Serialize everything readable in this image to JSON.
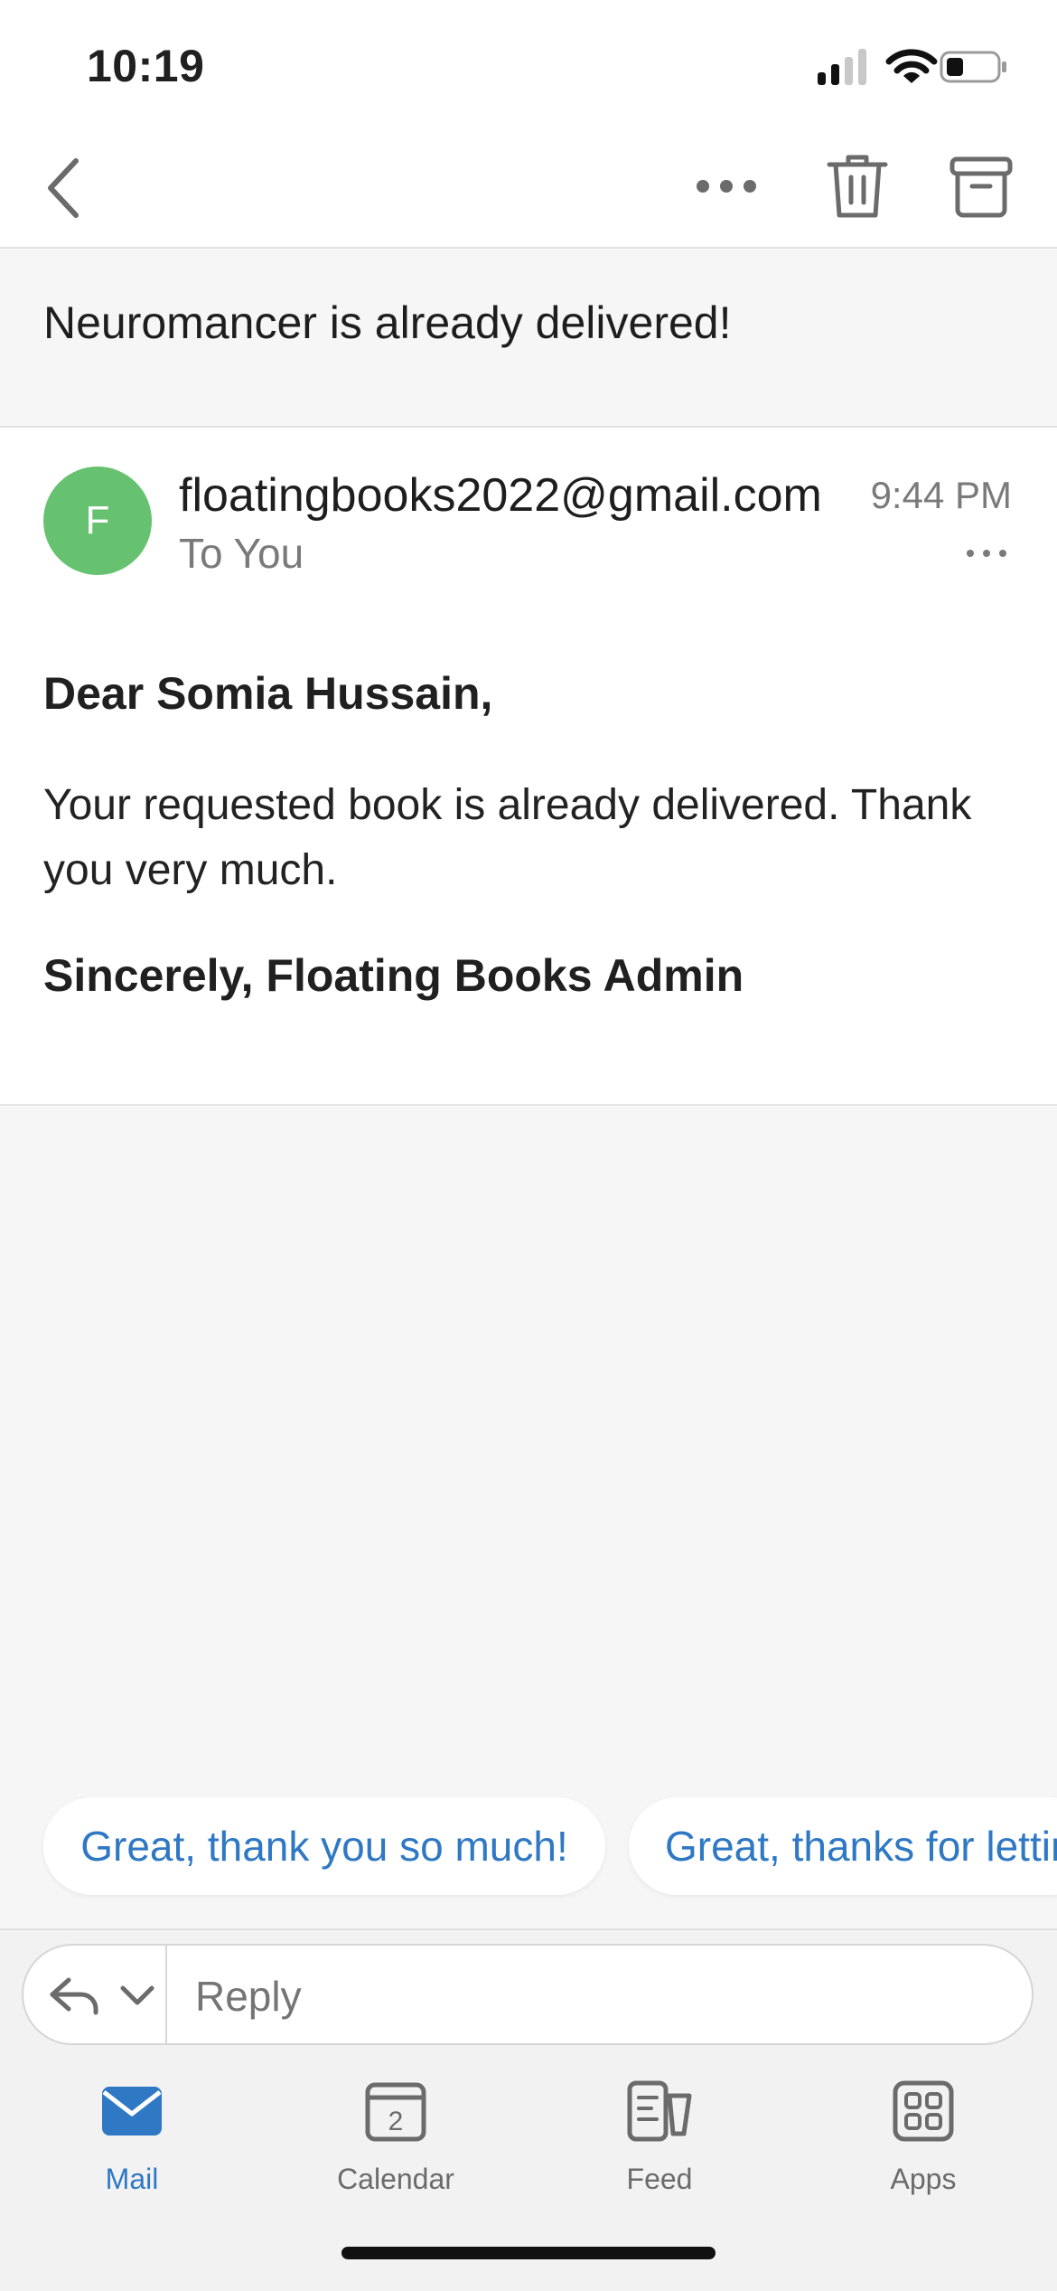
{
  "status_bar": {
    "time": "10:19"
  },
  "email": {
    "subject": "Neuromancer is already delivered!",
    "avatar_letter": "F",
    "sender": "floatingbooks2022@gmail.com",
    "recipient": "To You",
    "time": "9:44 PM",
    "greeting": "Dear Somia Hussain,",
    "body": "Your requested book is already delivered. Thank you very much.",
    "signoff": "Sincerely, Floating Books Admin"
  },
  "quick_replies": [
    "Great, thank you so much!",
    "Great, thanks for letting me know!"
  ],
  "reply": {
    "placeholder": "Reply"
  },
  "tabs": [
    {
      "label": "Mail",
      "active": true
    },
    {
      "label": "Calendar",
      "badge": "2"
    },
    {
      "label": "Feed"
    },
    {
      "label": "Apps"
    }
  ],
  "colors": {
    "accent": "#2f78c4",
    "avatar": "#66c270"
  }
}
